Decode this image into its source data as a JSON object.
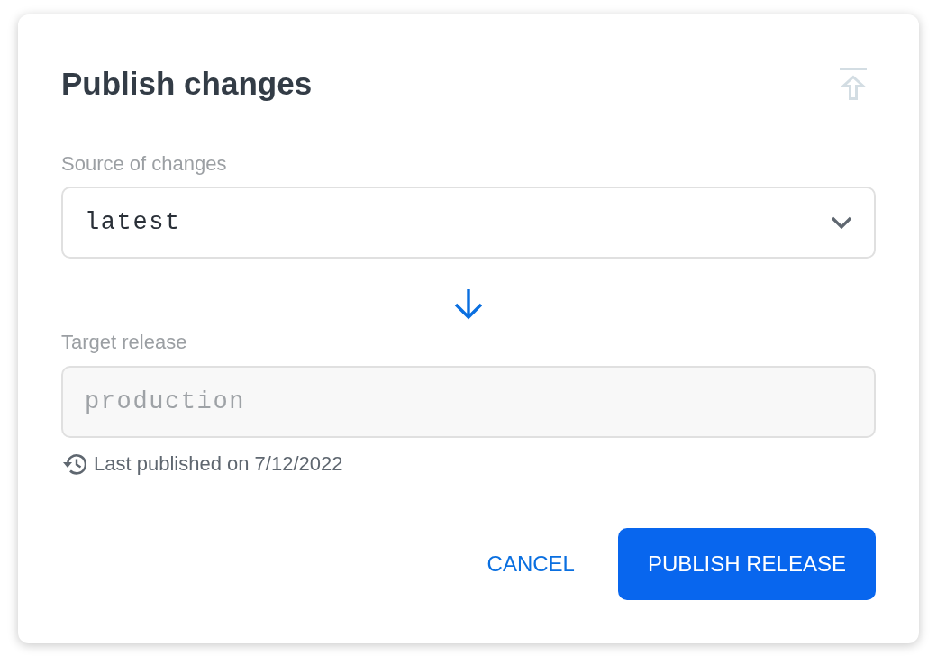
{
  "dialog": {
    "title": "Publish changes",
    "header_action": {
      "disabled": true
    }
  },
  "fields": [
    {
      "kind": "select",
      "label": "Source of changes",
      "value": "latest",
      "disabled": false
    },
    {
      "kind": "text",
      "label": "Target release",
      "value": "production",
      "disabled": true
    }
  ],
  "history_note": "Last published on 7/12/2022",
  "buttons": [
    {
      "label": "CANCEL",
      "kind": "text"
    },
    {
      "label": "PUBLISH RELEASE",
      "kind": "primary"
    }
  ]
}
